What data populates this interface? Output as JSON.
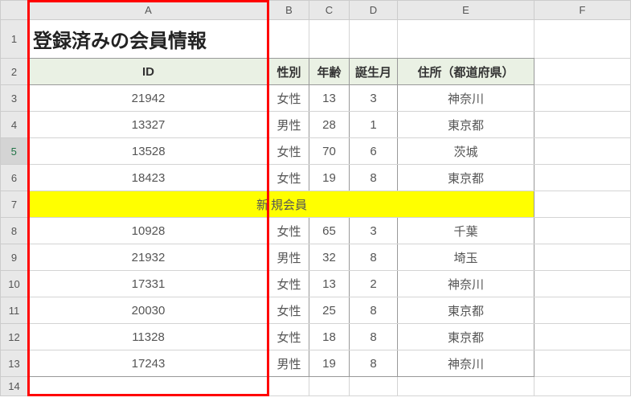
{
  "columns": [
    "A",
    "B",
    "C",
    "D",
    "E",
    "F"
  ],
  "rows": [
    "1",
    "2",
    "3",
    "4",
    "5",
    "6",
    "7",
    "8",
    "9",
    "10",
    "11",
    "12",
    "13",
    "14"
  ],
  "selected_row_header": "5",
  "title": "登録済みの会員情報",
  "table_headers": {
    "id": "ID",
    "sex": "性別",
    "age": "年齢",
    "birth_month": "誕生月",
    "address": "住所（都道府県）"
  },
  "merged_row_label": "新規会員",
  "data_rows_top": [
    {
      "id": "21942",
      "sex": "女性",
      "age": "13",
      "birth_month": "3",
      "address": "神奈川"
    },
    {
      "id": "13327",
      "sex": "男性",
      "age": "28",
      "birth_month": "1",
      "address": "東京都"
    },
    {
      "id": "13528",
      "sex": "女性",
      "age": "70",
      "birth_month": "6",
      "address": "茨城"
    },
    {
      "id": "18423",
      "sex": "女性",
      "age": "19",
      "birth_month": "8",
      "address": "東京都"
    }
  ],
  "data_rows_bottom": [
    {
      "id": "10928",
      "sex": "女性",
      "age": "65",
      "birth_month": "3",
      "address": "千葉"
    },
    {
      "id": "21932",
      "sex": "男性",
      "age": "32",
      "birth_month": "8",
      "address": "埼玉"
    },
    {
      "id": "17331",
      "sex": "女性",
      "age": "13",
      "birth_month": "2",
      "address": "神奈川"
    },
    {
      "id": "20030",
      "sex": "女性",
      "age": "25",
      "birth_month": "8",
      "address": "東京都"
    },
    {
      "id": "11328",
      "sex": "女性",
      "age": "18",
      "birth_month": "8",
      "address": "東京都"
    },
    {
      "id": "17243",
      "sex": "男性",
      "age": "19",
      "birth_month": "8",
      "address": "神奈川"
    }
  ],
  "chart_data": {
    "type": "table",
    "title": "登録済みの会員情報",
    "columns": [
      "ID",
      "性別",
      "年齢",
      "誕生月",
      "住所（都道府県）"
    ],
    "sections": [
      {
        "rows": [
          [
            21942,
            "女性",
            13,
            3,
            "神奈川"
          ],
          [
            13327,
            "男性",
            28,
            1,
            "東京都"
          ],
          [
            13528,
            "女性",
            70,
            6,
            "茨城"
          ],
          [
            18423,
            "女性",
            19,
            8,
            "東京都"
          ]
        ]
      },
      {
        "label": "新規会員",
        "rows": [
          [
            10928,
            "女性",
            65,
            3,
            "千葉"
          ],
          [
            21932,
            "男性",
            32,
            8,
            "埼玉"
          ],
          [
            17331,
            "女性",
            13,
            2,
            "神奈川"
          ],
          [
            20030,
            "女性",
            25,
            8,
            "東京都"
          ],
          [
            11328,
            "女性",
            18,
            8,
            "東京都"
          ],
          [
            17243,
            "男性",
            19,
            8,
            "神奈川"
          ]
        ]
      }
    ]
  }
}
